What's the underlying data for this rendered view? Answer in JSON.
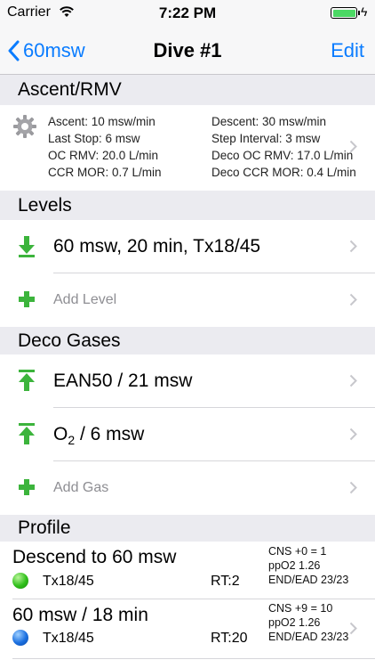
{
  "status_bar": {
    "carrier": "Carrier",
    "time": "7:22 PM"
  },
  "nav": {
    "back_label": "60msw",
    "title": "Dive #1",
    "edit_label": "Edit"
  },
  "ascent": {
    "header": "Ascent/RMV",
    "ascent": "Ascent: 10 msw/min",
    "descent": "Descent: 30 msw/min",
    "last_stop": "Last Stop: 6 msw",
    "step_interval": "Step Interval: 3 msw",
    "oc_rmv": "OC RMV: 20.0 L/min",
    "deco_oc_rmv": "Deco OC RMV: 17.0 L/min",
    "ccr_mor": "CCR MOR: 0.7 L/min",
    "deco_ccr_mor": "Deco CCR MOR: 0.4 L/min"
  },
  "levels": {
    "header": "Levels",
    "items": [
      {
        "label": "60 msw, 20 min, Tx18/45"
      }
    ],
    "add_label": "Add Level"
  },
  "deco_gases": {
    "header": "Deco Gases",
    "items": [
      {
        "label": "EAN50 / 21 msw"
      },
      {
        "label_prefix": "O",
        "label_sub": "2",
        "label_suffix": " / 6 msw"
      }
    ],
    "add_label": "Add Gas"
  },
  "profile": {
    "header": "Profile",
    "items": [
      {
        "title": "Descend to 60 msw",
        "gas": "Tx18/45",
        "rt": "RT:2",
        "cns": "CNS +0 = 1",
        "ppo2": "ppO2 1.26",
        "end_ead": "END/EAD 23/23",
        "dot_color": "#2fbf1a"
      },
      {
        "title": "60 msw / 18 min",
        "gas": "Tx18/45",
        "rt": "RT:20",
        "cns": "CNS +9 = 10",
        "ppo2": "ppO2 1.26",
        "end_ead": "END/EAD 23/23",
        "dot_color": "#1a6fe0"
      }
    ]
  },
  "colors": {
    "accent": "#0a7cff",
    "green_icon": "#3cb43c",
    "header_bg": "#ebebf0"
  }
}
